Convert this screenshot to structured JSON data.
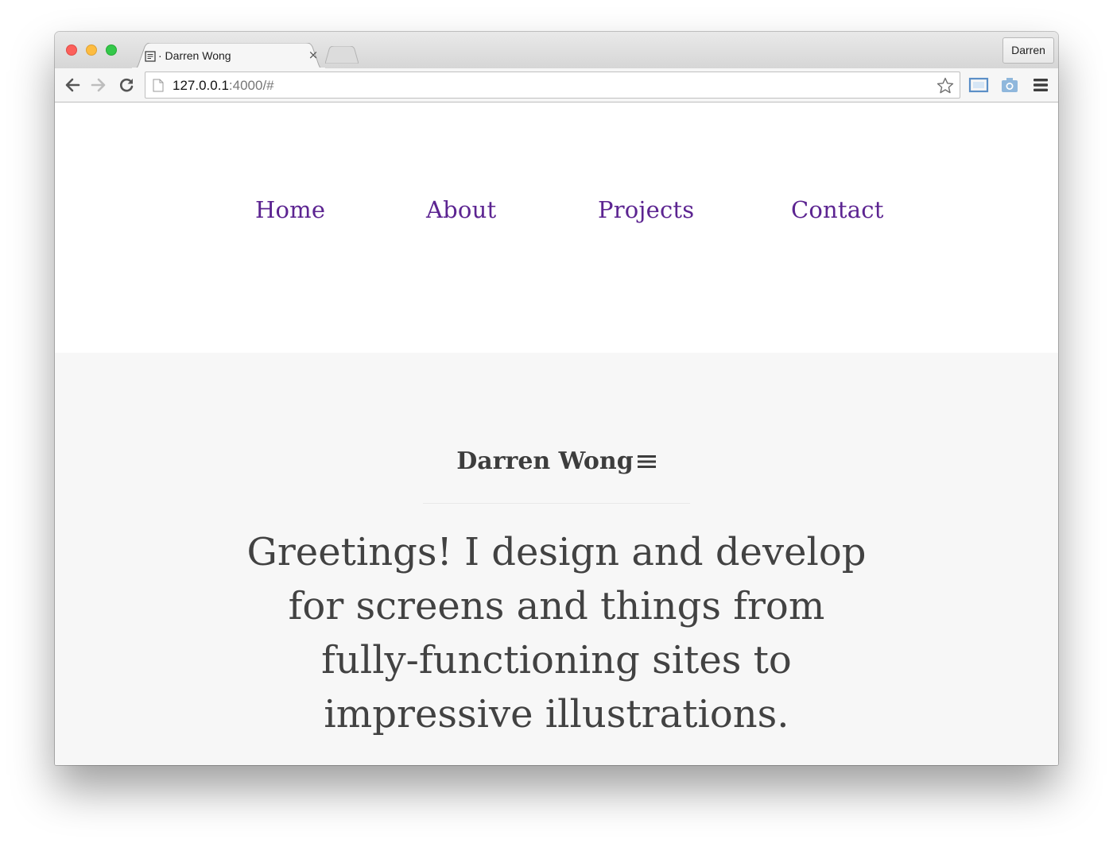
{
  "browser": {
    "tab": {
      "title": "· Darren Wong",
      "favicon": "page-icon"
    },
    "profile_label": "Darren",
    "url": {
      "host": "127.0.0.1",
      "rest": ":4000/#"
    },
    "icons": {
      "back": "back-arrow-icon",
      "forward": "forward-arrow-icon",
      "reload": "reload-icon",
      "bookmark": "star-icon",
      "cast": "cast-icon",
      "screenshot": "camera-icon",
      "menu": "hamburger-menu-icon"
    }
  },
  "site": {
    "nav": [
      {
        "label": "Home"
      },
      {
        "label": "About"
      },
      {
        "label": "Projects"
      },
      {
        "label": "Contact"
      }
    ],
    "brand": "Darren Wong",
    "tagline": "Greetings! I design and develop for screens and things from fully-functioning sites to impressive illustrations.",
    "colors": {
      "link": "#5c2491",
      "text": "#424242",
      "hero_bg": "#f7f7f7"
    }
  }
}
